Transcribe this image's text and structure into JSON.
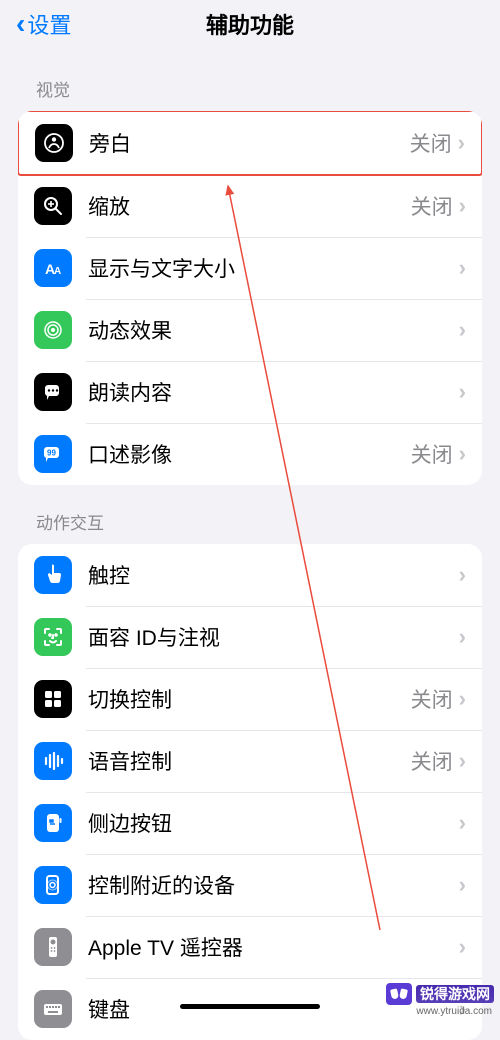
{
  "header": {
    "back": "设置",
    "title": "辅助功能"
  },
  "sections": {
    "vision": {
      "header": "视觉",
      "items": [
        {
          "label": "旁白",
          "value": "关闭",
          "icon": "voiceover",
          "bg": "#000000"
        },
        {
          "label": "缩放",
          "value": "关闭",
          "icon": "zoom",
          "bg": "#000000"
        },
        {
          "label": "显示与文字大小",
          "value": "",
          "icon": "text-size",
          "bg": "#007aff"
        },
        {
          "label": "动态效果",
          "value": "",
          "icon": "motion",
          "bg": "#34c759"
        },
        {
          "label": "朗读内容",
          "value": "",
          "icon": "speech",
          "bg": "#000000"
        },
        {
          "label": "口述影像",
          "value": "关闭",
          "icon": "audio-desc",
          "bg": "#007aff"
        }
      ]
    },
    "motor": {
      "header": "动作交互",
      "items": [
        {
          "label": "触控",
          "value": "",
          "icon": "touch",
          "bg": "#007aff"
        },
        {
          "label": "面容 ID与注视",
          "value": "",
          "icon": "faceid",
          "bg": "#34c759"
        },
        {
          "label": "切换控制",
          "value": "关闭",
          "icon": "switch",
          "bg": "#000000"
        },
        {
          "label": "语音控制",
          "value": "关闭",
          "icon": "voice-control",
          "bg": "#007aff"
        },
        {
          "label": "侧边按钮",
          "value": "",
          "icon": "side-button",
          "bg": "#007aff"
        },
        {
          "label": "控制附近的设备",
          "value": "",
          "icon": "nearby",
          "bg": "#007aff"
        },
        {
          "label": "Apple TV 遥控器",
          "value": "",
          "icon": "remote",
          "bg": "#8e8e93"
        },
        {
          "label": "键盘",
          "value": "",
          "icon": "keyboard",
          "bg": "#8e8e93"
        }
      ]
    }
  },
  "watermark": {
    "brand": "锐得游戏网",
    "url": "www.ytruida.com"
  }
}
